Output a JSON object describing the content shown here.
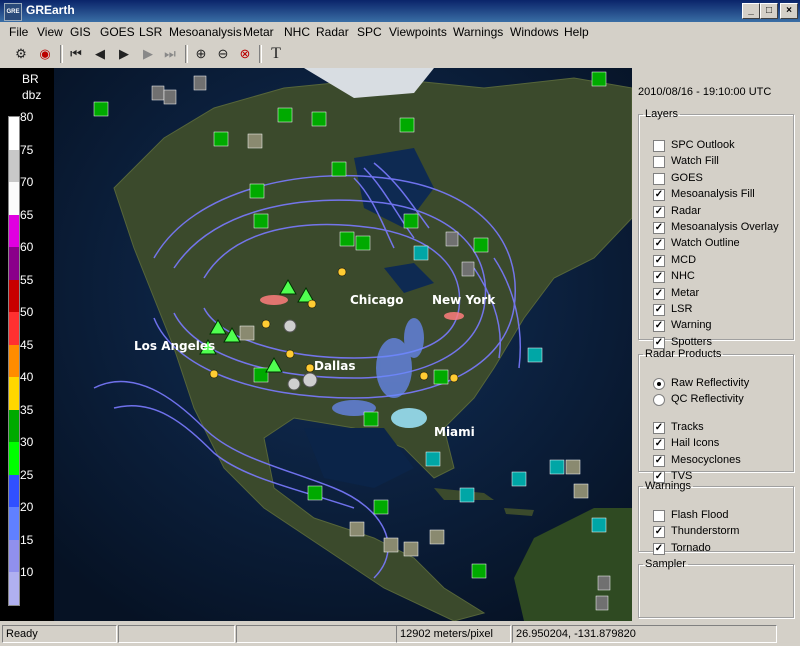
{
  "window": {
    "title": "GREarth",
    "icon_text": "GRE"
  },
  "menu": [
    "File",
    "View",
    "GIS",
    "GOES",
    "LSR",
    "Mesoanalysis",
    "Metar",
    "NHC",
    "Radar",
    "SPC",
    "Viewpoints",
    "Warnings",
    "Windows",
    "Help"
  ],
  "legend": {
    "product": "BR",
    "unit": "dbz",
    "ticks": [
      "80",
      "75",
      "70",
      "65",
      "60",
      "55",
      "50",
      "45",
      "40",
      "35",
      "30",
      "25",
      "20",
      "15",
      "10"
    ],
    "colors": [
      "#ffffff",
      "#c8c8c8",
      "#fbfbfb",
      "#e000e0",
      "#8a008a",
      "#c80000",
      "#ff3030",
      "#ff8c00",
      "#ffd700",
      "#00aa00",
      "#00ff00",
      "#3050ff",
      "#6080ff",
      "#9090ee",
      "#b0b0f0"
    ]
  },
  "map": {
    "labels": [
      "Los Angeles",
      "Dallas",
      "Chicago",
      "New York",
      "Miami",
      "Chicago"
    ]
  },
  "datetime": "2010/08/16 - 19:10:00 UTC",
  "layers": {
    "title": "Layers",
    "items": [
      {
        "label": "SPC Outlook",
        "checked": false
      },
      {
        "label": "Watch Fill",
        "checked": false
      },
      {
        "label": "GOES",
        "checked": false
      },
      {
        "label": "Mesoanalysis Fill",
        "checked": true
      },
      {
        "label": "Radar",
        "checked": true
      },
      {
        "label": "Mesoanalysis Overlay",
        "checked": true
      },
      {
        "label": "Watch Outline",
        "checked": true
      },
      {
        "label": "MCD",
        "checked": true
      },
      {
        "label": "NHC",
        "checked": true
      },
      {
        "label": "Metar",
        "checked": true
      },
      {
        "label": "LSR",
        "checked": true
      },
      {
        "label": "Warning",
        "checked": true
      },
      {
        "label": "Spotters",
        "checked": true
      }
    ]
  },
  "radar_products": {
    "title": "Radar Products",
    "radios": [
      {
        "label": "Raw Reflectivity",
        "selected": true
      },
      {
        "label": "QC Reflectivity",
        "selected": false
      }
    ],
    "items": [
      {
        "label": "Tracks",
        "checked": true
      },
      {
        "label": "Hail Icons",
        "checked": true
      },
      {
        "label": "Mesocyclones",
        "checked": true
      },
      {
        "label": "TVS",
        "checked": true
      }
    ]
  },
  "warnings": {
    "title": "Warnings",
    "items": [
      {
        "label": "Flash Flood",
        "checked": false
      },
      {
        "label": "Thunderstorm",
        "checked": true
      },
      {
        "label": "Tornado",
        "checked": true
      }
    ]
  },
  "sampler": {
    "title": "Sampler"
  },
  "status": {
    "state": "Ready",
    "scale": "12902 meters/pixel",
    "coords": "26.950204, -131.879820"
  }
}
